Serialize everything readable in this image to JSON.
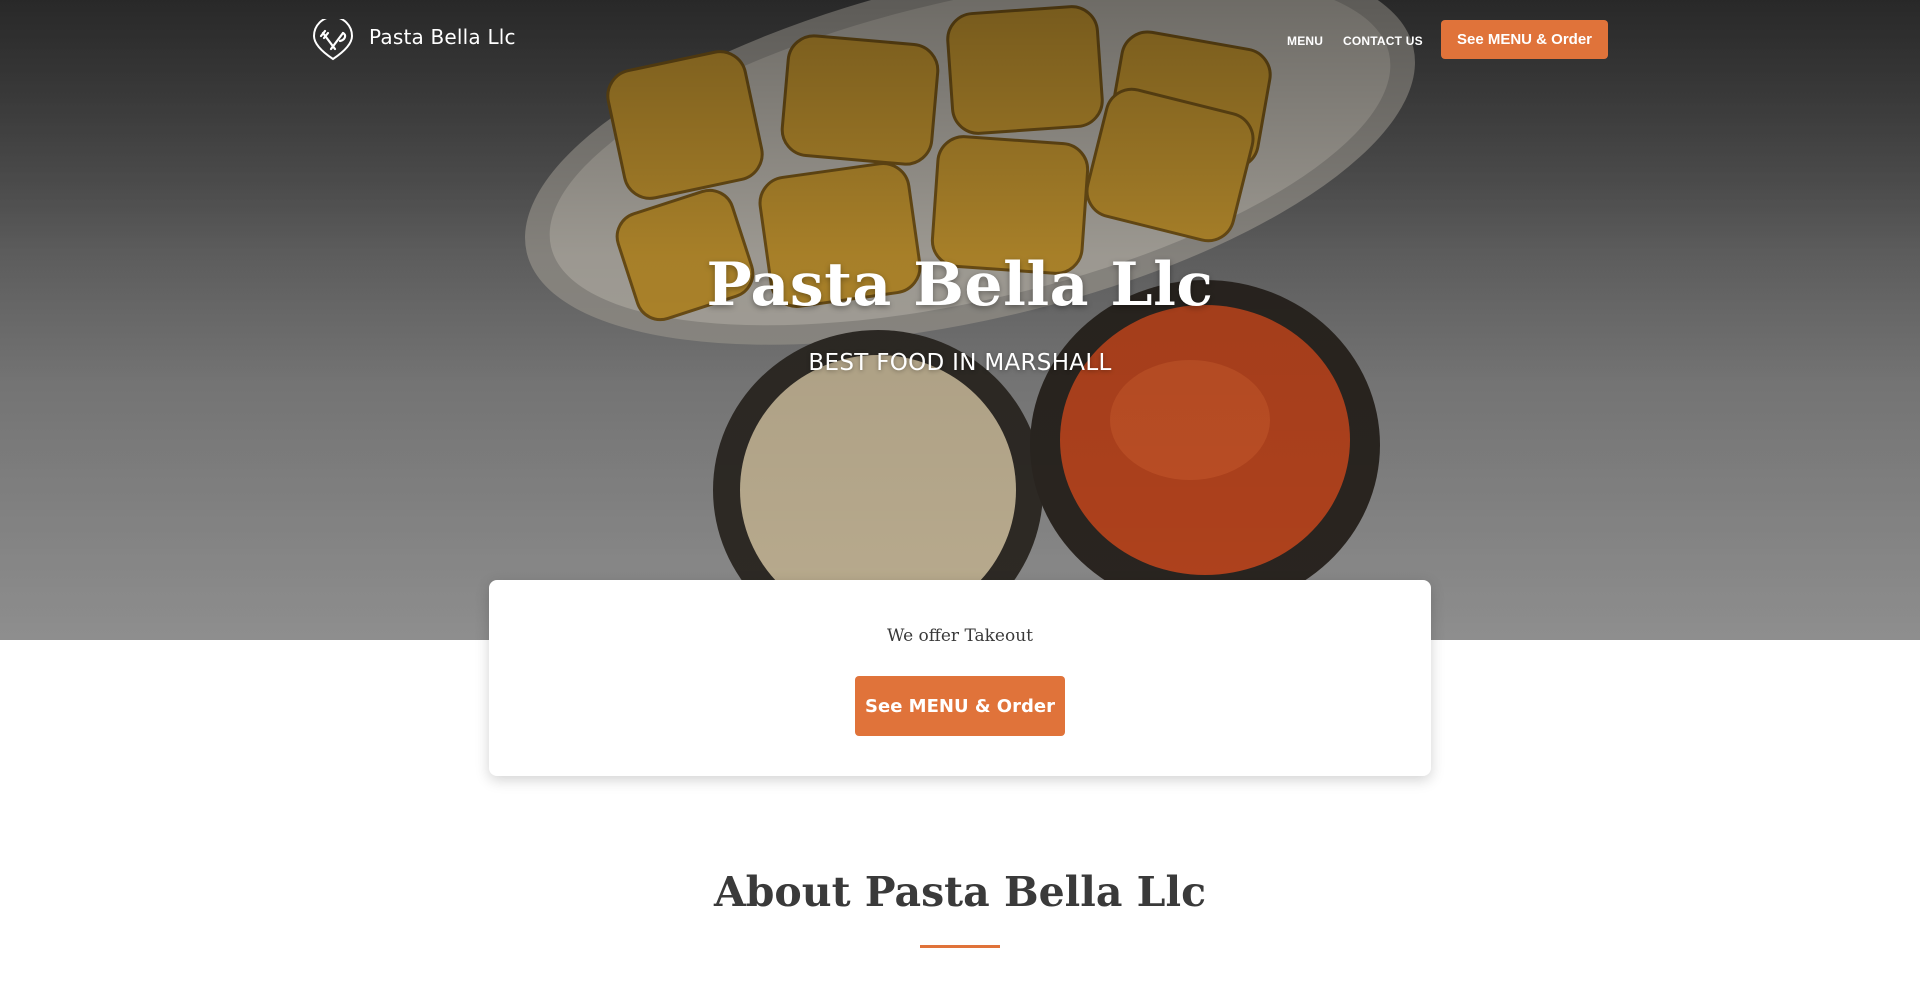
{
  "nav": {
    "brand_name": "Pasta Bella Llc",
    "links": [
      "MENU",
      "CONTACT US"
    ],
    "cta_label": "See MENU & Order"
  },
  "hero": {
    "title": "Pasta Bella Llc",
    "subtitle": "BEST FOOD IN MARSHALL"
  },
  "takeout": {
    "text": "We offer Takeout",
    "button_label": "See MENU & Order"
  },
  "about": {
    "title": "About Pasta Bella Llc"
  },
  "colors": {
    "accent": "#e0733a",
    "text_dark": "#3a3a3a",
    "white": "#ffffff"
  },
  "icons": {
    "brand_logo": "fork-knife-icon"
  }
}
